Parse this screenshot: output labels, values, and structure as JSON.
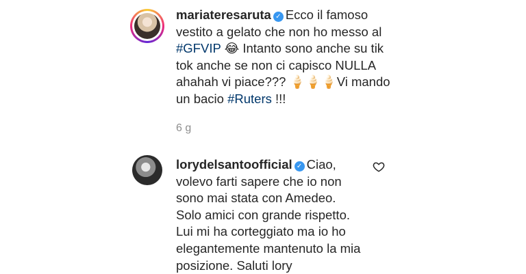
{
  "comments": [
    {
      "username": "mariateresaruta",
      "lines": [
        [
          "Ecco il famoso"
        ],
        [
          "vestito a gelato che non ho messo al"
        ],
        [
          "#GFVIP",
          " 😂 Intanto sono anche su tik"
        ],
        [
          "tok anche se non ci capisco NULLA"
        ],
        [
          "ahahah vi piace??? 🍦🍦🍦Vi mando"
        ],
        [
          "un bacio ",
          "#Ruters",
          " !!!"
        ]
      ],
      "time": "6 g"
    },
    {
      "username": "lorydelsantoofficial",
      "lines": [
        "Ciao,",
        "volevo farti sapere che io non",
        "sono mai stata con Amedeo.",
        "Solo amici con grande rispetto.",
        "Lui mi ha corteggiato ma io ho",
        "elegantemente mantenuto la mia",
        "posizione. Saluti lory"
      ]
    }
  ],
  "icons": {
    "verified": "verified-badge-icon",
    "like": "heart-outline-icon"
  },
  "colors": {
    "hashtag": "#00376b",
    "verified": "#3897f0",
    "meta": "#8e8e8e"
  }
}
